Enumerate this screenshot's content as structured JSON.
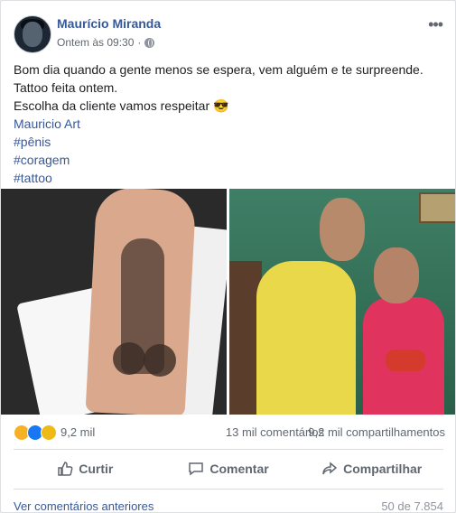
{
  "post": {
    "author": "Maurício Miranda",
    "time": "Ontem às 09:30",
    "more_icon": "more-options-icon",
    "lines": [
      "Bom dia quando a gente menos se espera, vem alguém e te surpreende.",
      "Tattoo feita ontem.",
      "Escolha da cliente vamos respeitar 😎"
    ],
    "links": [
      "Mauricio Art",
      "#pênis",
      "#coragem",
      "#tattoo"
    ]
  },
  "stats": {
    "reaction_count": "9,2 mil",
    "comments": "13 mil comentários",
    "shares": "9,2 mil compartilhamentos"
  },
  "actions": {
    "like": "Curtir",
    "comment": "Comentar",
    "share": "Compartilhar"
  },
  "footer": {
    "view_previous": "Ver comentários anteriores",
    "count": "50 de 7.854"
  },
  "colors": {
    "link": "#385898",
    "secondary_text": "#606770"
  }
}
